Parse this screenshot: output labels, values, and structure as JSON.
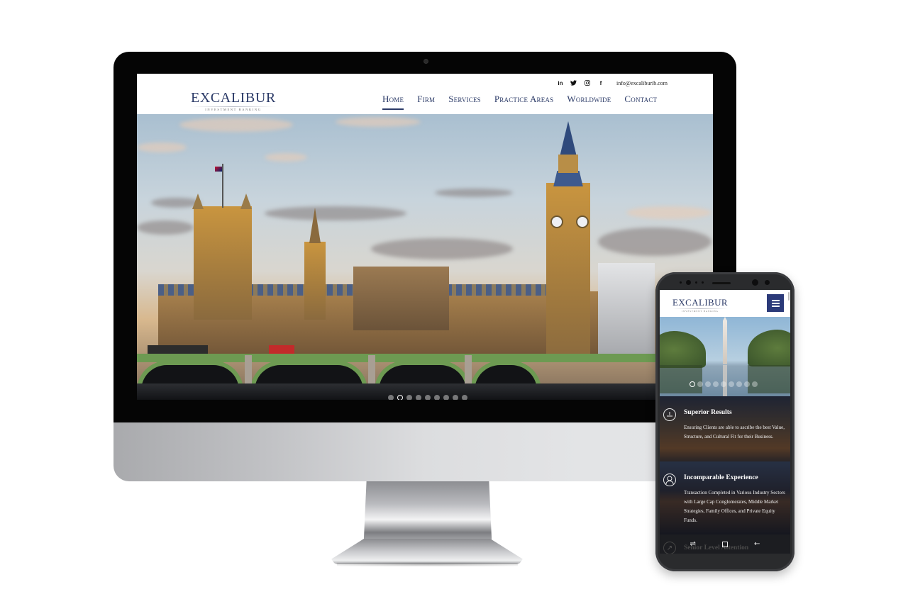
{
  "site": {
    "logo": {
      "title": "EXCALIBUR",
      "subtitle": "INVESTMENT BANKING"
    },
    "topbar": {
      "social": [
        {
          "name": "linkedin",
          "glyph": "in"
        },
        {
          "name": "twitter",
          "glyph": "🐦︎"
        },
        {
          "name": "instagram",
          "glyph": "◎"
        },
        {
          "name": "facebook",
          "glyph": "f"
        }
      ],
      "email": "info@excaliburib.com"
    },
    "nav": [
      {
        "label": "Home",
        "active": true
      },
      {
        "label": "Firm",
        "active": false
      },
      {
        "label": "Services",
        "active": false
      },
      {
        "label": "Practice Areas",
        "active": false
      },
      {
        "label": "Worldwide",
        "active": false
      },
      {
        "label": "Contact",
        "active": false
      }
    ],
    "hero": {
      "scene": "Houses of Parliament and Big Ben, London",
      "slide_count": 9,
      "active_slide": 2
    }
  },
  "mobile": {
    "logo": {
      "title": "EXCALIBUR",
      "subtitle": "INVESTMENT BANKING"
    },
    "menu_icon": "hamburger-icon",
    "hero": {
      "scene": "Washington Monument reflecting pool",
      "slide_count": 9,
      "active_slide": 1
    },
    "features": [
      {
        "icon": "clock-icon",
        "title": "Superior Results",
        "text": "Ensuring Clients are able to ascribe the best Value, Structure, and Cultural Fit for their Business."
      },
      {
        "icon": "user-icon",
        "title": "Incomparable Experience",
        "text": "Transaction Completed in Various Industry Sectors with Large Cap Conglomerates, Middle Market Strategies, Family Offices, and Private Equity Funds."
      },
      {
        "icon": "chart-icon",
        "title": "Senior Level Attention"
      }
    ],
    "navbar": {
      "recent": "⇌",
      "home": "□",
      "back": "←"
    }
  },
  "colors": {
    "brand_navy": "#2b3a67",
    "menu_button": "#2b3a79"
  }
}
